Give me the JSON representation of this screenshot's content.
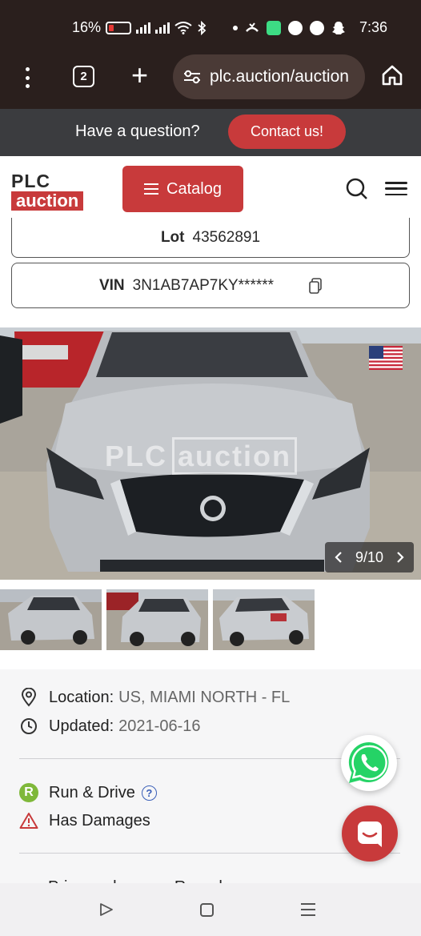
{
  "status_bar": {
    "battery": "16%",
    "time": "7:36",
    "icons": [
      "battery-icon",
      "signal-icon",
      "signal-icon",
      "wifi-icon",
      "bluetooth-icon",
      "dot-icon",
      "missed-call-icon",
      "app-notification-icon",
      "whatsapp-icon",
      "messenger-icon",
      "snapchat-icon"
    ]
  },
  "browser": {
    "tab_count": "2",
    "url": "plc.auction/auction",
    "icons": [
      "kebab-menu-icon",
      "tabs-icon",
      "new-tab-icon",
      "site-settings-icon",
      "home-icon"
    ]
  },
  "contact_bar": {
    "question": "Have a question?",
    "button_label": "Contact us!"
  },
  "site_header": {
    "logo_top": "PLC",
    "logo_bottom": "auction",
    "catalog_label": "Catalog",
    "accent_color": "#c83a3b"
  },
  "lot": {
    "lot_label": "Lot",
    "lot_number": "43562891",
    "vin_label": "VIN",
    "vin_value": "3N1AB7AP7KY******"
  },
  "gallery": {
    "watermark_left": "PLC",
    "watermark_right": "auction",
    "counter": "9/10",
    "thumbnail_count": 3
  },
  "details": {
    "location_label": "Location:",
    "location_value": "US, MIAMI NORTH - FL",
    "updated_label": "Updated:",
    "updated_value": "2021-06-16",
    "run_drive_badge": "R",
    "run_drive_label": "Run & Drive",
    "help_badge": "?",
    "damages_label": "Has Damages",
    "primary_damage_partial": "Primary damage: Rear damage"
  }
}
